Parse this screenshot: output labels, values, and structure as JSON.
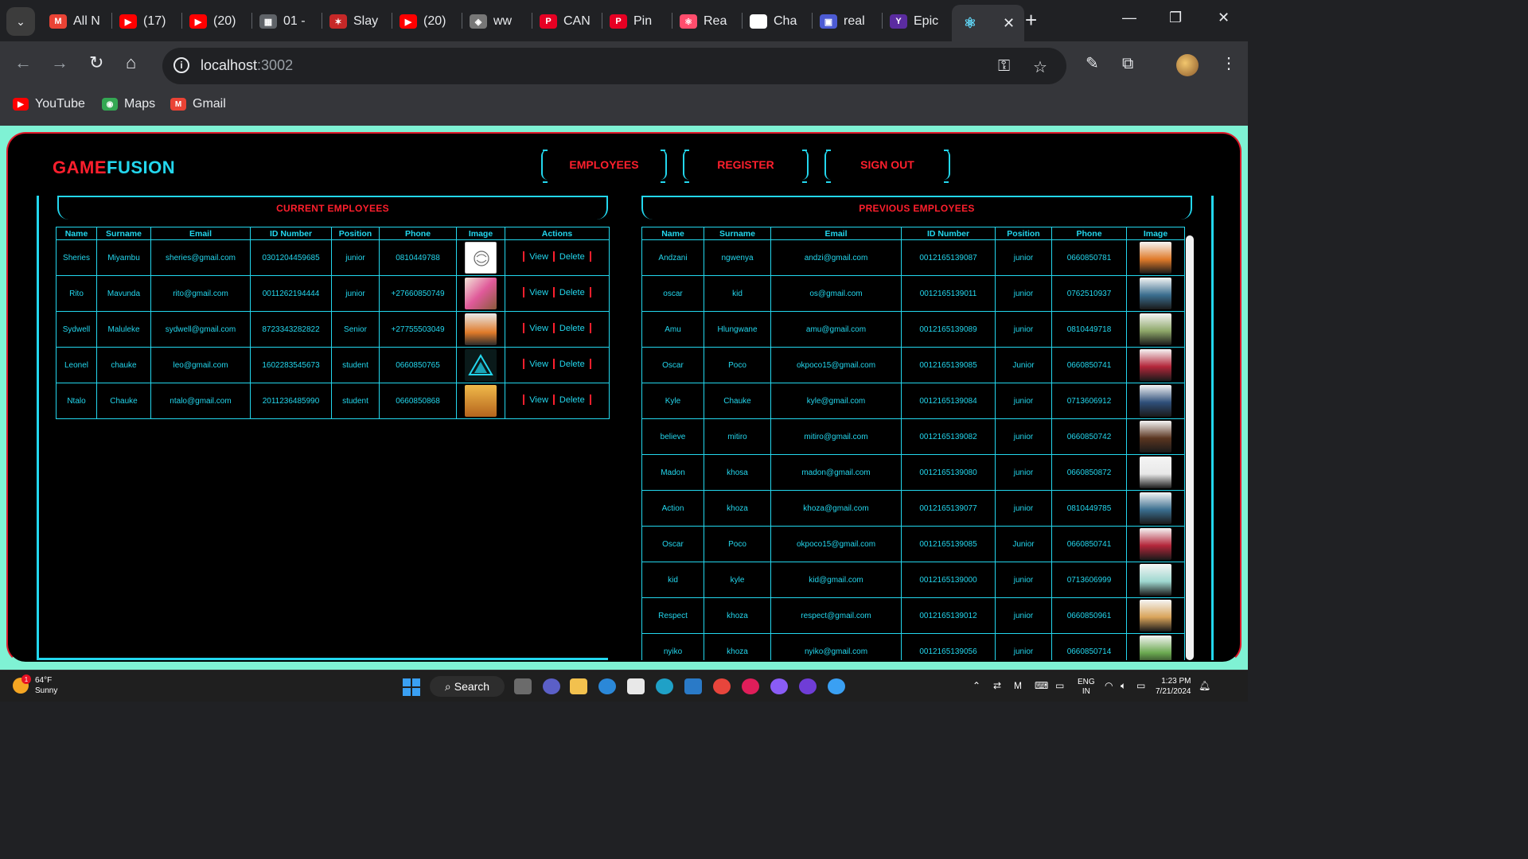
{
  "browser": {
    "tabs": [
      {
        "label": "All N",
        "fav": "M",
        "color": "#ea4335"
      },
      {
        "label": "(17)",
        "fav": "▶",
        "color": "#ff0000"
      },
      {
        "label": "(20)",
        "fav": "▶",
        "color": "#ff0000"
      },
      {
        "label": "01 -",
        "fav": "▦",
        "color": "#5f6368"
      },
      {
        "label": "Slay",
        "fav": "✶",
        "color": "#c62828"
      },
      {
        "label": "(20)",
        "fav": "▶",
        "color": "#ff0000"
      },
      {
        "label": "ww",
        "fav": "◈",
        "color": "#777777"
      },
      {
        "label": "CAN",
        "fav": "P",
        "color": "#e60023"
      },
      {
        "label": "Pin",
        "fav": "P",
        "color": "#e60023"
      },
      {
        "label": "Rea",
        "fav": "⚛",
        "color": "#ff4d6d"
      },
      {
        "label": "Cha",
        "fav": "◎",
        "color": "#ffffff"
      },
      {
        "label": "real",
        "fav": "▣",
        "color": "#4c5bd4"
      },
      {
        "label": "Epic",
        "fav": "Y",
        "color": "#5b2ca0"
      }
    ],
    "active_tab_icon": "react-icon",
    "url_host": "localhost",
    "url_port": ":3002",
    "bookmarks": [
      {
        "label": "YouTube",
        "fav": "▶",
        "color": "#ff0000"
      },
      {
        "label": "Maps",
        "fav": "◉",
        "color": "#34a853"
      },
      {
        "label": "Gmail",
        "fav": "M",
        "color": "#ea4335"
      }
    ]
  },
  "app": {
    "logo_game": "GAME",
    "logo_fusion": "FUSION",
    "nav": {
      "employees": "EMPLOYEES",
      "register": "REGISTER",
      "signout": "SIGN OUT"
    },
    "colors": {
      "accent": "#23d7ee",
      "brand_red": "#ff1f2d",
      "background": "#000000",
      "page_bg": "#7ff2d4"
    }
  },
  "current": {
    "title": "CURRENT EMPLOYEES",
    "headers": [
      "Name",
      "Surname",
      "Email",
      "ID Number",
      "Position",
      "Phone",
      "Image",
      "Actions"
    ],
    "view_label": "View",
    "delete_label": "Delete",
    "rows": [
      {
        "name": "Sheries",
        "surname": "Miyambu",
        "email": "sheries@gmail.com",
        "id": "0301204459685",
        "position": "junior",
        "phone": "0810449788",
        "img": "brain-outline"
      },
      {
        "name": "Rito",
        "surname": "Mavunda",
        "email": "rito@gmail.com",
        "id": "0011262194444",
        "position": "junior",
        "phone": "+27660850749",
        "img": "group-photo"
      },
      {
        "name": "Sydwell",
        "surname": "Maluleke",
        "email": "sydwell@gmail.com",
        "id": "8723343282822",
        "position": "Senior",
        "phone": "+27755503049",
        "img": "person-orange"
      },
      {
        "name": "Leonel",
        "surname": "chauke",
        "email": "leo@gmail.com",
        "id": "1602283545673",
        "position": "student",
        "phone": "0660850765",
        "img": "teal-triangle-logo"
      },
      {
        "name": "Ntalo",
        "surname": "Chauke",
        "email": "ntalo@gmail.com",
        "id": "2011236485990",
        "position": "student",
        "phone": "0660850868",
        "img": "cartoon-character"
      }
    ]
  },
  "previous": {
    "title": "PREVIOUS EMPLOYEES",
    "headers": [
      "Name",
      "Surname",
      "Email",
      "ID Number",
      "Position",
      "Phone",
      "Image"
    ],
    "rows": [
      {
        "name": "Andzani",
        "surname": "ngwenya",
        "email": "andzi@gmail.com",
        "id": "0012165139087",
        "position": "junior",
        "phone": "0660850781",
        "img": "#e07b2a"
      },
      {
        "name": "oscar",
        "surname": "kid",
        "email": "os@gmail.com",
        "id": "0012165139011",
        "position": "junior",
        "phone": "0762510937",
        "img": "#3b6e8f"
      },
      {
        "name": "Amu",
        "surname": "Hlungwane",
        "email": "amu@gmail.com",
        "id": "0012165139089",
        "position": "junior",
        "phone": "0810449718",
        "img": "#8fa86a"
      },
      {
        "name": "Oscar",
        "surname": "Poco",
        "email": "okpoco15@gmail.com",
        "id": "0012165139085",
        "position": "Junior",
        "phone": "0660850741",
        "img": "#b3263a"
      },
      {
        "name": "Kyle",
        "surname": "Chauke",
        "email": "kyle@gmail.com",
        "id": "0012165139084",
        "position": "junior",
        "phone": "0713606912",
        "img": "#2f4f7a"
      },
      {
        "name": "believe",
        "surname": "mitiro",
        "email": "mitiro@gmail.com",
        "id": "0012165139082",
        "position": "junior",
        "phone": "0660850742",
        "img": "#5a3520"
      },
      {
        "name": "Madon",
        "surname": "khosa",
        "email": "madon@gmail.com",
        "id": "0012165139080",
        "position": "junior",
        "phone": "0660850872",
        "img": "#e8e8e8"
      },
      {
        "name": "Action",
        "surname": "khoza",
        "email": "khoza@gmail.com",
        "id": "0012165139077",
        "position": "junior",
        "phone": "0810449785",
        "img": "#3b6e8f"
      },
      {
        "name": "Oscar",
        "surname": "Poco",
        "email": "okpoco15@gmail.com",
        "id": "0012165139085",
        "position": "Junior",
        "phone": "0660850741",
        "img": "#b3263a"
      },
      {
        "name": "kid",
        "surname": "kyle",
        "email": "kid@gmail.com",
        "id": "0012165139000",
        "position": "junior",
        "phone": "0713606999",
        "img": "#9fd8d0"
      },
      {
        "name": "Respect",
        "surname": "khoza",
        "email": "respect@gmail.com",
        "id": "0012165139012",
        "position": "junior",
        "phone": "0660850961",
        "img": "#d9a45a"
      },
      {
        "name": "nyiko",
        "surname": "khoza",
        "email": "nyiko@gmail.com",
        "id": "0012165139056",
        "position": "junior",
        "phone": "0660850714",
        "img": "#6aa84f"
      }
    ]
  },
  "taskbar": {
    "temp": "64°F",
    "weather": "Sunny",
    "weather_badge": "1",
    "search_label": "Search",
    "lang": "ENG",
    "region": "IN",
    "time": "1:23 PM",
    "date": "7/21/2024"
  }
}
